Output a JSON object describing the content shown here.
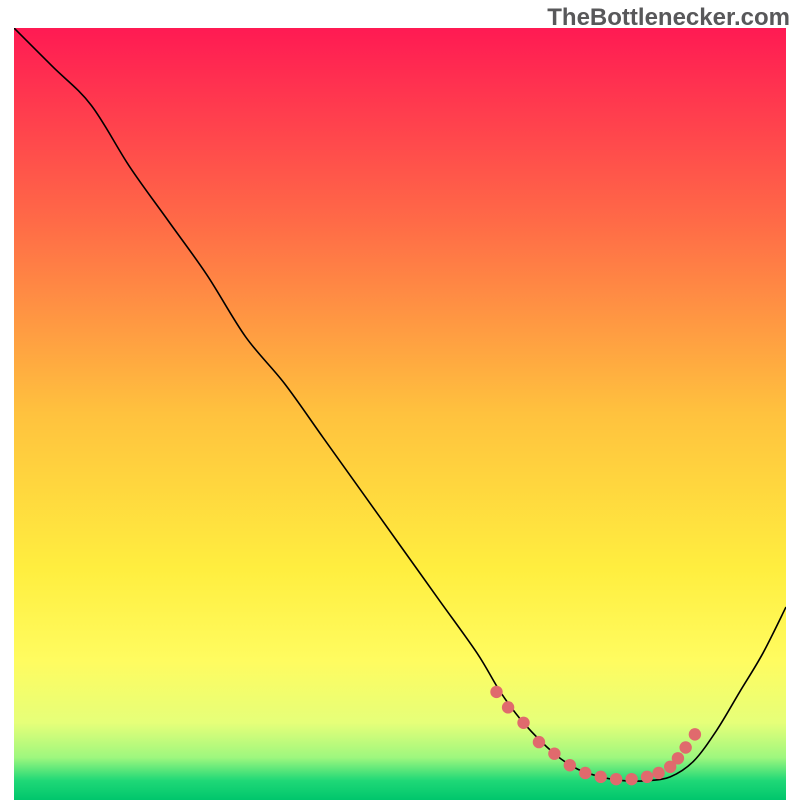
{
  "watermark": "TheBottlenecker.com",
  "chart_data": {
    "type": "line",
    "title": "",
    "xlabel": "",
    "ylabel": "",
    "xlim": [
      0,
      100
    ],
    "ylim": [
      0,
      100
    ],
    "grid": false,
    "legend": false,
    "notes": "No axis ticks or numeric labels are visible. Values are estimated from curve geometry relative to the plot box (0–100 on each axis).",
    "background_gradient": {
      "orientation": "vertical",
      "stops": [
        {
          "offset": 0.0,
          "color": "#ff1a53"
        },
        {
          "offset": 0.25,
          "color": "#ff6a47"
        },
        {
          "offset": 0.5,
          "color": "#ffc23e"
        },
        {
          "offset": 0.7,
          "color": "#ffee3f"
        },
        {
          "offset": 0.82,
          "color": "#fffc60"
        },
        {
          "offset": 0.9,
          "color": "#e6ff79"
        },
        {
          "offset": 0.945,
          "color": "#9ef77e"
        },
        {
          "offset": 0.975,
          "color": "#1fd877"
        },
        {
          "offset": 1.0,
          "color": "#00c66c"
        }
      ]
    },
    "series": [
      {
        "name": "bottleneck-curve",
        "color": "#000000",
        "stroke_width": 1.6,
        "x": [
          0,
          5,
          10,
          15,
          20,
          25,
          30,
          35,
          40,
          45,
          50,
          55,
          60,
          63,
          66,
          70,
          73,
          76,
          79,
          82,
          85,
          88,
          91,
          94,
          97,
          100
        ],
        "y": [
          100,
          95,
          90,
          82,
          75,
          68,
          60,
          54,
          47,
          40,
          33,
          26,
          19,
          14,
          10,
          6,
          4,
          3,
          2.5,
          2.5,
          3,
          5,
          9,
          14,
          19,
          25
        ]
      }
    ],
    "highlight": {
      "name": "flat-zone-dots",
      "color": "#e06a6d",
      "radius": 6.2,
      "points_x": [
        62.5,
        64,
        66,
        68,
        70,
        72,
        74,
        76,
        78,
        80,
        82,
        83.5,
        85,
        86,
        87,
        88.2
      ],
      "points_y": [
        14,
        12,
        10,
        7.5,
        6,
        4.5,
        3.5,
        3,
        2.7,
        2.7,
        3,
        3.5,
        4.3,
        5.4,
        6.8,
        8.5
      ]
    }
  }
}
